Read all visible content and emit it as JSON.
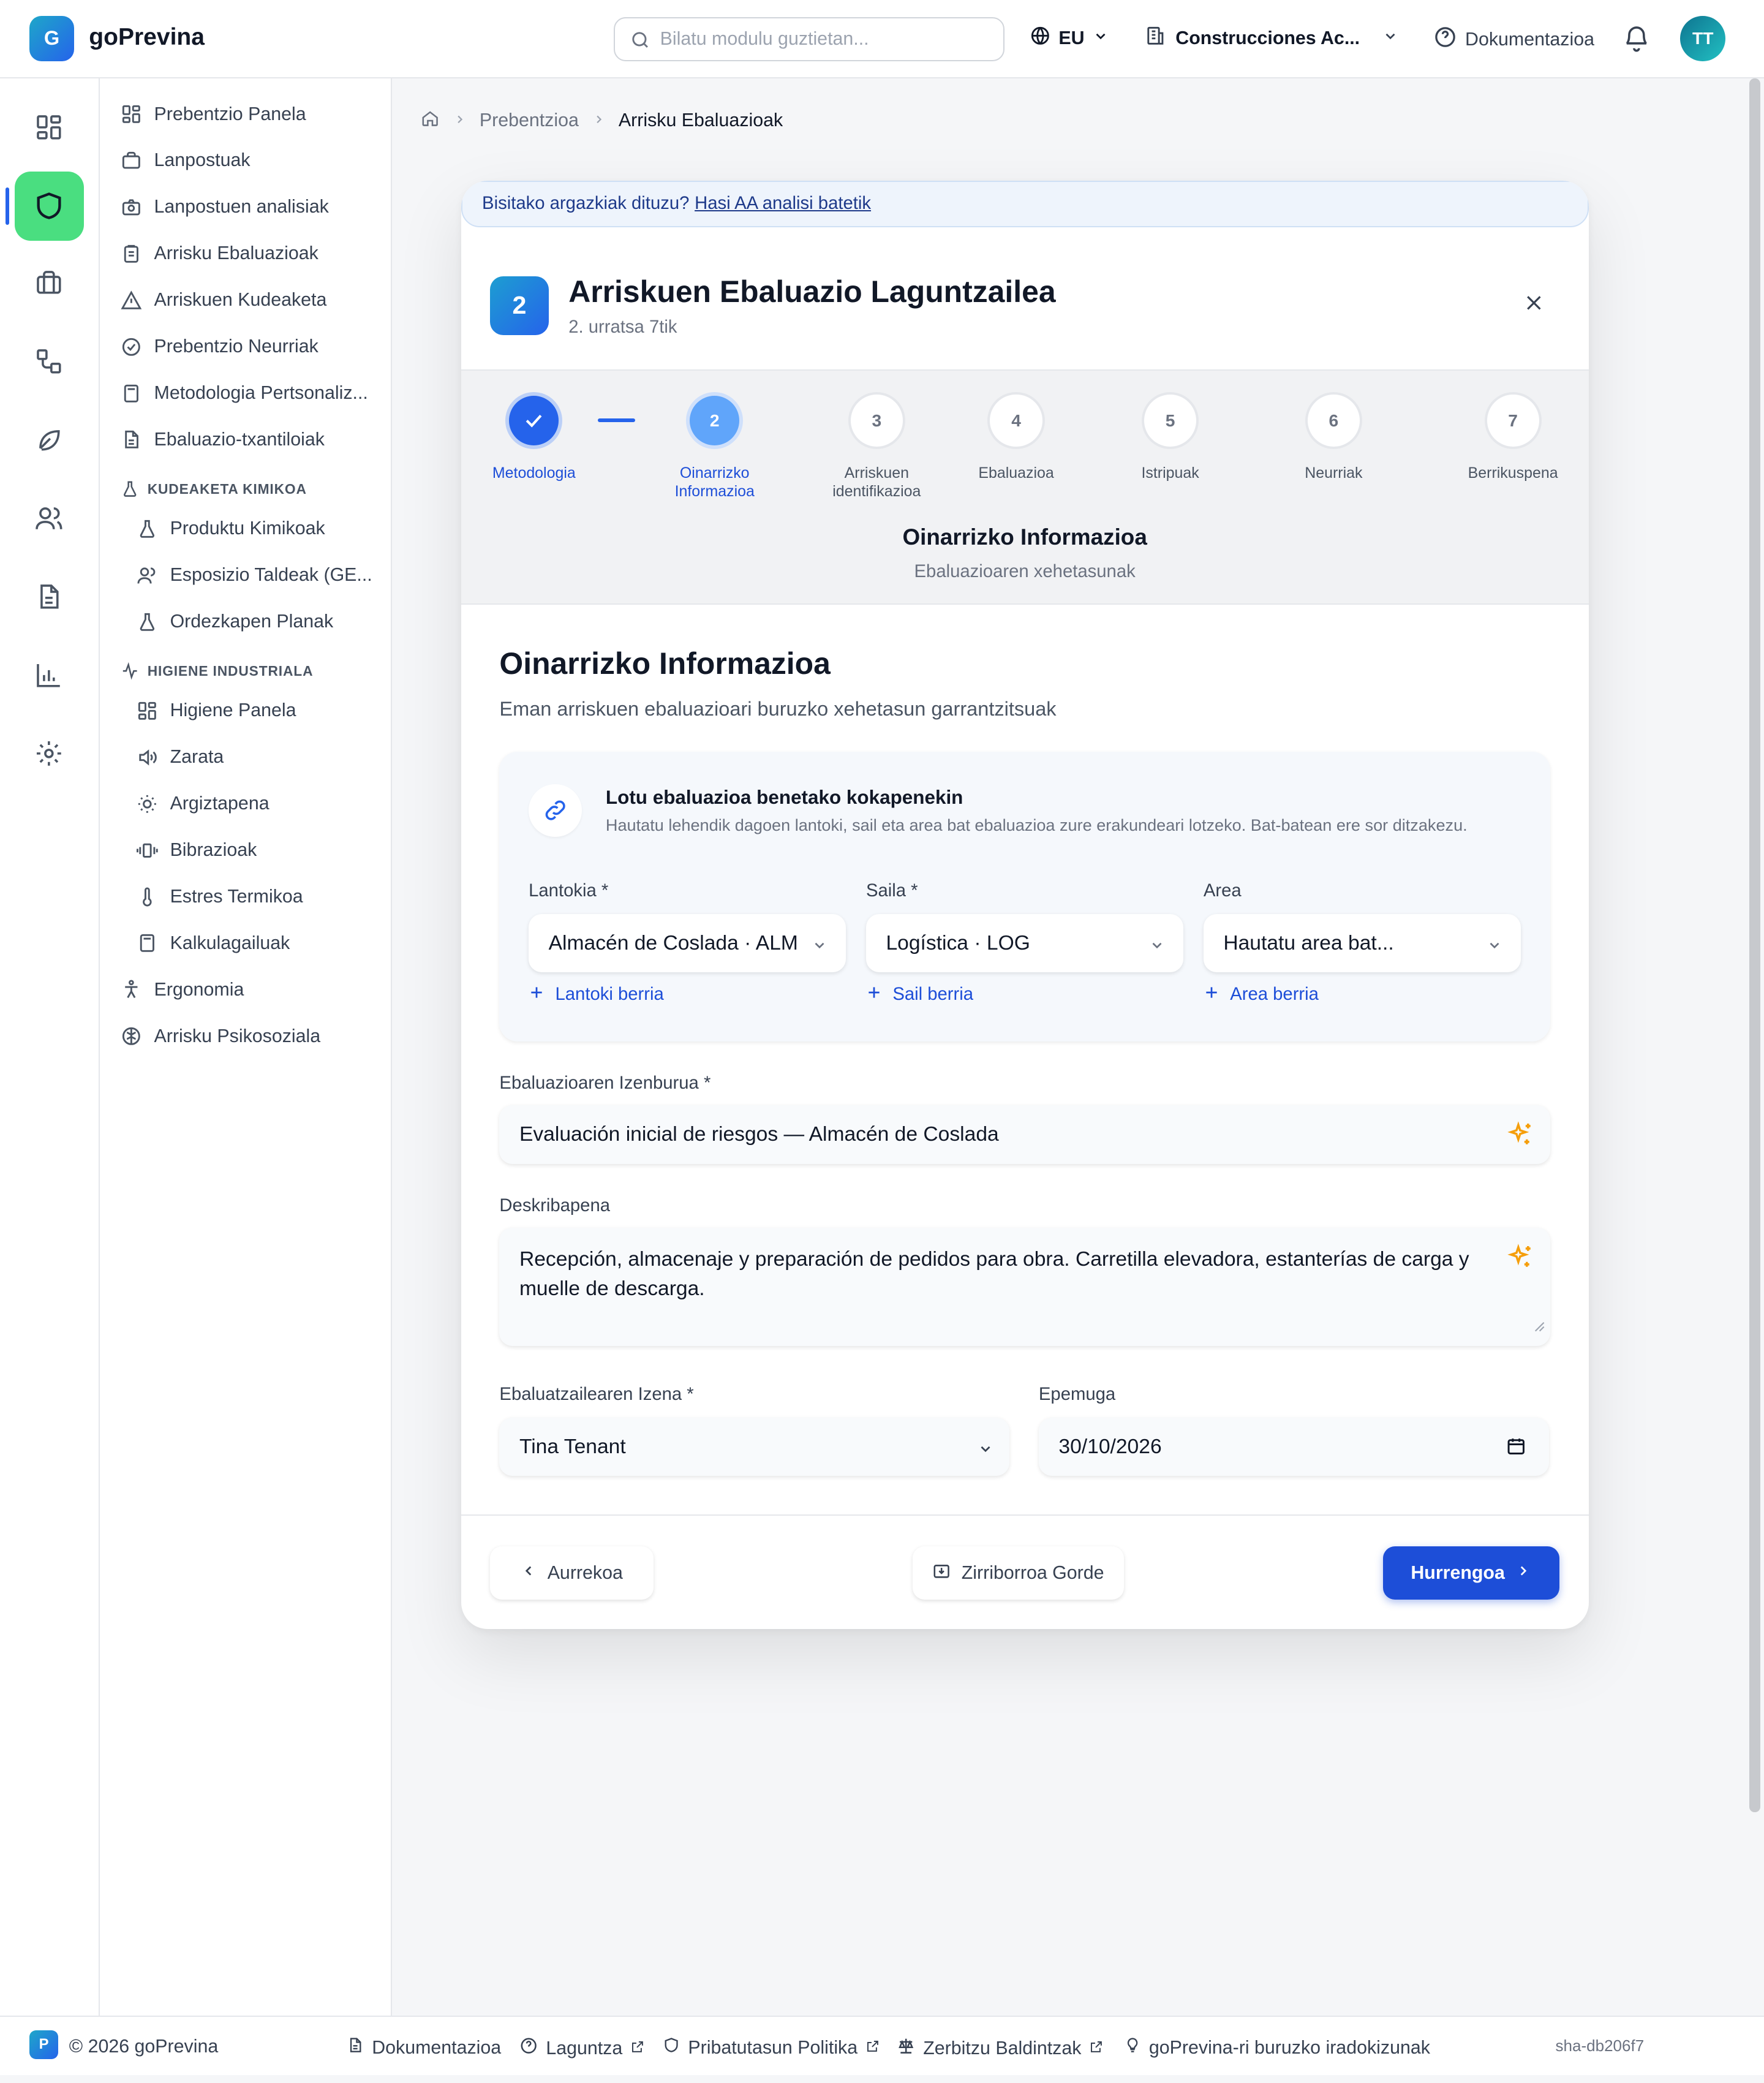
{
  "app": {
    "name": "goPrevina",
    "logo_letter": "G"
  },
  "topbar": {
    "search_placeholder": "Bilatu modulu guztietan...",
    "language": "EU",
    "company": "Construcciones Ac...",
    "docs": "Dokumentazioa",
    "avatar_initials": "TT"
  },
  "rail": {
    "icons": [
      "dashboard-icon",
      "shield-icon",
      "briefcase-icon",
      "workflow-icon",
      "leaf-icon",
      "users-icon",
      "document-icon",
      "chart-icon",
      "settings-icon"
    ],
    "active": "shield-icon"
  },
  "sidebar": {
    "items": [
      {
        "label": "Prebentzio Panela",
        "icon": "dashboard-icon"
      },
      {
        "label": "Lanpostuak",
        "icon": "briefcase-icon"
      },
      {
        "label": "Lanpostuen analisiak",
        "icon": "camera-icon"
      },
      {
        "label": "Arrisku Ebaluazioak",
        "icon": "clipboard-icon"
      },
      {
        "label": "Arriskuen Kudeaketa",
        "icon": "warning-icon"
      },
      {
        "label": "Prebentzio Neurriak",
        "icon": "check-circle-icon"
      },
      {
        "label": "Metodologia Pertsonaliz...",
        "icon": "calculator-icon"
      },
      {
        "label": "Ebaluazio-txantiloiak",
        "icon": "file-icon"
      }
    ],
    "chem_section": "KUDEAKETA KIMIKOA",
    "chem_items": [
      {
        "label": "Produktu Kimikoak",
        "icon": "flask-icon"
      },
      {
        "label": "Esposizio Taldeak (GE...",
        "icon": "users-icon"
      },
      {
        "label": "Ordezkapen Planak",
        "icon": "flask-icon"
      }
    ],
    "hyg_section": "HIGIENE INDUSTRIALA",
    "hyg_items": [
      {
        "label": "Higiene Panela",
        "icon": "dashboard-icon"
      },
      {
        "label": "Zarata",
        "icon": "speaker-icon"
      },
      {
        "label": "Argiztapena",
        "icon": "sun-icon"
      },
      {
        "label": "Bibrazioak",
        "icon": "vibration-icon"
      },
      {
        "label": "Estres Termikoa",
        "icon": "thermometer-icon"
      },
      {
        "label": "Kalkulagailuak",
        "icon": "calculator-icon"
      }
    ],
    "bottom_items": [
      {
        "label": "Ergonomia",
        "icon": "person-icon"
      },
      {
        "label": "Arrisku Psikosoziala",
        "icon": "brain-icon"
      }
    ]
  },
  "breadcrumb": {
    "parent": "Prebentzioa",
    "current": "Arrisku Ebaluazioak"
  },
  "wizard": {
    "banner_text": "Bisitako argazkiak dituzu?",
    "banner_link": "Hasi AA analisi batetik",
    "step_number": "2",
    "title": "Arriskuen Ebaluazio Laguntzailea",
    "subtitle": "2. urratsa 7tik",
    "steps": [
      {
        "num": "1",
        "label": "Metodologia",
        "state": "done"
      },
      {
        "num": "2",
        "label": "Oinarrizko Informazioa",
        "state": "active"
      },
      {
        "num": "3",
        "label": "Arriskuen identifikazioa",
        "state": "todo"
      },
      {
        "num": "4",
        "label": "Ebaluazioa",
        "state": "todo"
      },
      {
        "num": "5",
        "label": "Istripuak",
        "state": "todo"
      },
      {
        "num": "6",
        "label": "Neurriak",
        "state": "todo"
      },
      {
        "num": "7",
        "label": "Berrikuspena",
        "state": "todo"
      }
    ],
    "current_step_title": "Oinarrizko Informazioa",
    "current_step_desc": "Ebaluazioaren xehetasunak"
  },
  "form": {
    "title": "Oinarrizko Informazioa",
    "subtitle": "Eman arriskuen ebaluazioari buruzko xehetasun garrantzitsuak",
    "link_box": {
      "title": "Lotu ebaluazioa benetako kokapenekin",
      "desc": "Hautatu lehendik dagoen lantoki, sail eta area bat ebaluazioa zure erakundeari lotzeko. Bat-batean ere sor ditzakezu.",
      "workplace_label": "Lantokia *",
      "workplace_value": "Almacén de Coslada · ALM",
      "workplace_add": "Lantoki berria",
      "department_label": "Saila *",
      "department_value": "Logística · LOG",
      "department_add": "Sail berria",
      "area_label": "Area",
      "area_value": "Hautatu area bat...",
      "area_add": "Area berria"
    },
    "title_label": "Ebaluazioaren Izenburua *",
    "title_value": "Evaluación inicial de riesgos — Almacén de Coslada",
    "desc_label": "Deskribapena",
    "desc_value": "Recepción, almacenaje y preparación de pedidos para obra. Carretilla elevadora, estanterías de carga y muelle de descarga.",
    "evaluator_label": "Ebaluatzailearen Izena *",
    "evaluator_value": "Tina Tenant",
    "deadline_label": "Epemuga",
    "deadline_value": "30/10/2026"
  },
  "buttons": {
    "prev": "Aurrekoa",
    "save_draft": "Zirriborroa Gorde",
    "next": "Hurrengoa"
  },
  "footer": {
    "badge": "P",
    "copyright": "© 2026 goPrevina",
    "docs": "Dokumentazioa",
    "help": "Laguntza",
    "privacy": "Pribatutasun Politika",
    "terms": "Zerbitzu Baldintzak",
    "suggestions": "goPrevina-ri buruzko iradokizunak",
    "sha": "sha-db206f7"
  },
  "colors": {
    "accent": "#1d4ed8",
    "rail_active": "#4ade80",
    "brand_gradient_start": "#1ea7c9",
    "brand_gradient_end": "#2563eb"
  }
}
